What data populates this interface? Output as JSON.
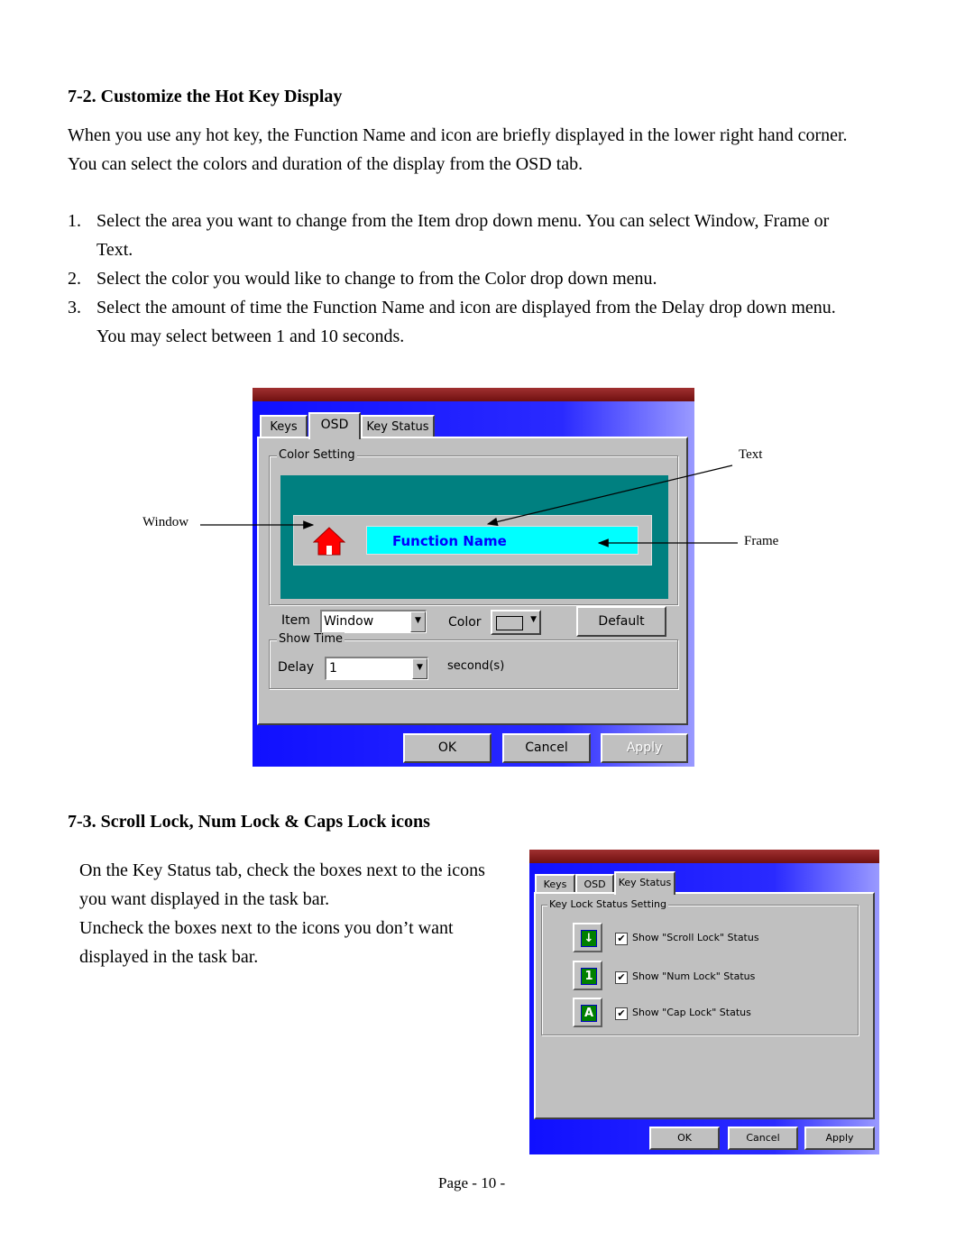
{
  "section1": {
    "heading": "7-2. Customize the Hot Key Display",
    "intro": [
      "When you use any hot key, the Function Name and icon are briefly displayed in the lower right hand corner.",
      "You can select the colors and duration of the display from the OSD tab."
    ],
    "steps": [
      {
        "num": "1.",
        "lines": [
          "Select the area you want to change from the Item drop down menu. You can select Window, Frame or",
          "Text."
        ]
      },
      {
        "num": "2.",
        "lines": [
          "Select the color you would like to change to from the Color drop down menu."
        ]
      },
      {
        "num": "3.",
        "lines": [
          "Select the amount of time the Function Name and icon are displayed from the Delay drop down menu.",
          "You may select between 1 and 10 seconds."
        ]
      }
    ]
  },
  "dialog1": {
    "tabs": [
      "Keys",
      "OSD",
      "Key Status"
    ],
    "active_tab": "OSD",
    "color_group": "Color Setting",
    "preview_text": "Function Name",
    "preview_icon": "house-icon",
    "item_label": "Item",
    "item_value": "Window",
    "color_label": "Color",
    "default_button": "Default",
    "show_group": "Show Time",
    "delay_label": "Delay",
    "delay_value": "1",
    "delay_unit": "second(s)",
    "buttons": [
      "OK",
      "Cancel",
      "Apply"
    ],
    "apply_disabled": true,
    "colors": {
      "window": "#008080",
      "frame": "#c0c0c0",
      "text_bg": "#00ffff",
      "text": "#0000ff"
    },
    "annotations": {
      "window": "Window",
      "text": "Text",
      "frame": "Frame"
    }
  },
  "section2": {
    "heading": "7-3. Scroll Lock, Num Lock & Caps Lock icons",
    "lines": [
      "On the Key Status tab, check the boxes next to the icons",
      "you want displayed in the task bar.",
      "Uncheck the boxes next to the icons you don’t want",
      "displayed in the task bar."
    ]
  },
  "dialog2": {
    "tabs": [
      "Keys",
      "OSD",
      "Key Status"
    ],
    "active_tab": "Key Status",
    "group": "Key Lock Status Setting",
    "options": [
      {
        "icon": "scroll-lock-icon",
        "glyph": "↓",
        "label": "Show \"Scroll Lock\" Status",
        "checked": true
      },
      {
        "icon": "num-lock-icon",
        "glyph": "1",
        "label": "Show \"Num Lock\" Status",
        "checked": true
      },
      {
        "icon": "caps-lock-icon",
        "glyph": "A",
        "label": "Show \"Cap Lock\" Status",
        "checked": true
      }
    ],
    "buttons": [
      "OK",
      "Cancel",
      "Apply"
    ]
  },
  "footer": "Page - 10 -"
}
